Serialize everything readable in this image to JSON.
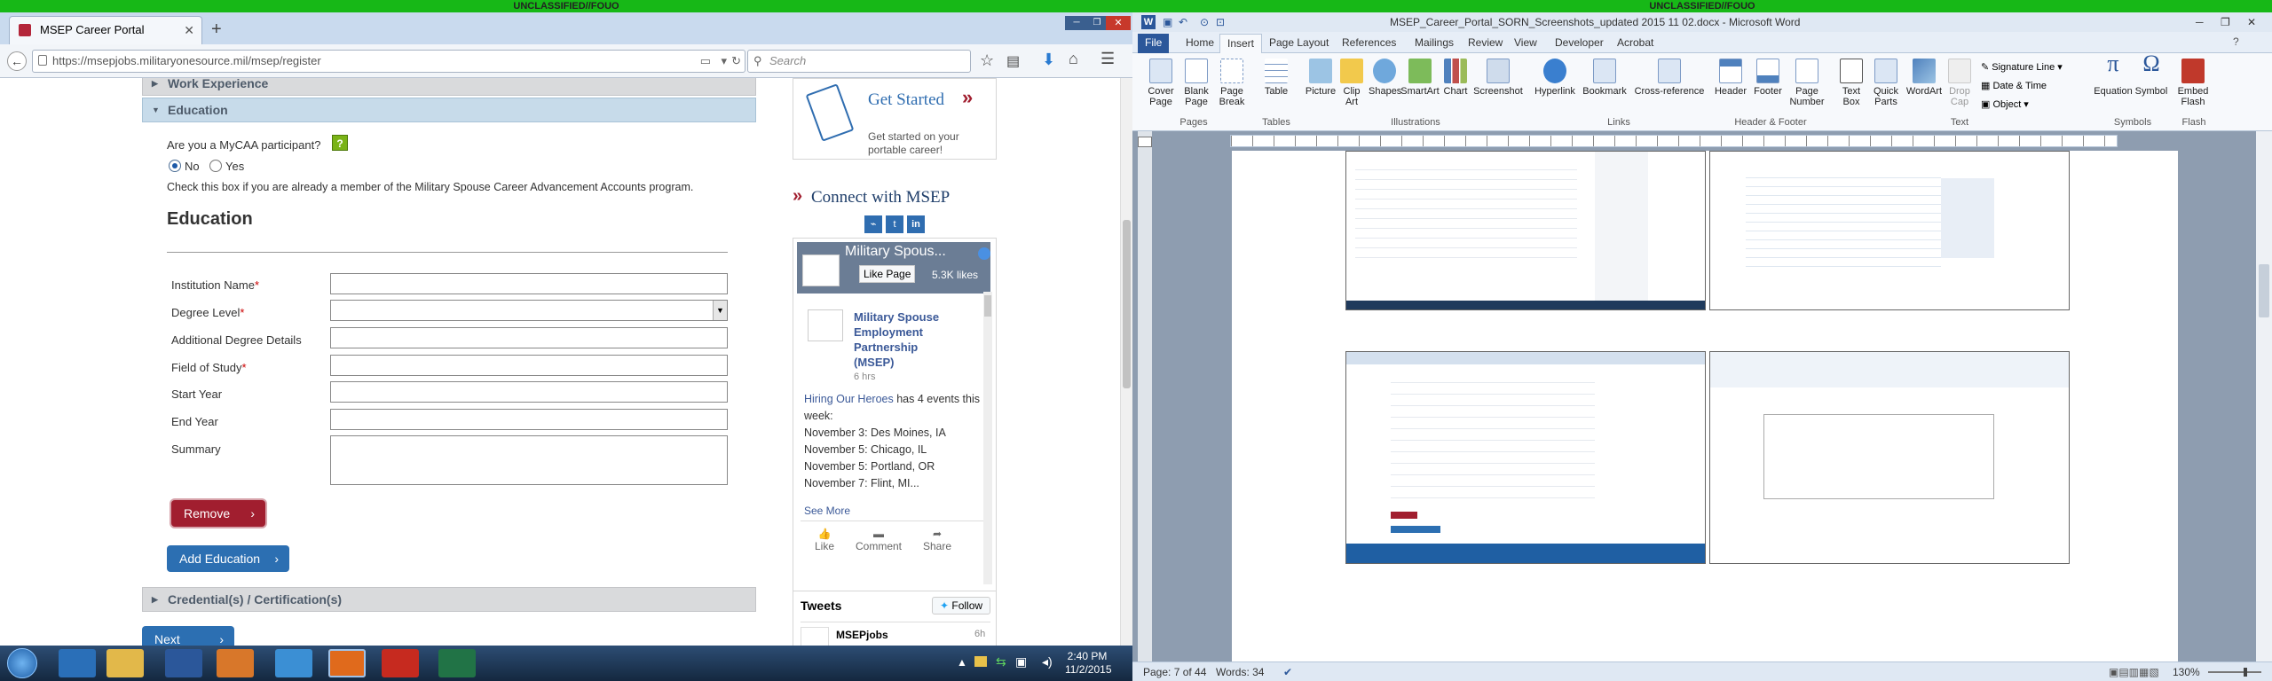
{
  "banner": {
    "left": "UNCLASSIFIED//FOUO",
    "right": "UNCLASSIFIED//FOUO"
  },
  "browser": {
    "tab_title": "MSEP Career Portal",
    "new_tab": "+",
    "url": "https://msepjobs.militaryonesource.mil/msep/register",
    "search_placeholder": "Search"
  },
  "form": {
    "sections": {
      "work_experience": "Work Experience",
      "education": "Education",
      "credentials": "Credential(s) / Certification(s)"
    },
    "mycaa_question": "Are you a MyCAA participant?",
    "mycaa_help": "?",
    "radio_no": "No",
    "radio_yes": "Yes",
    "mycaa_hint": "Check this box if you are already a member of the Military Spouse Career Advancement Accounts program.",
    "heading": "Education",
    "fields": {
      "institution": "Institution Name",
      "degree": "Degree Level",
      "additional": "Additional Degree Details",
      "field": "Field of Study",
      "start": "Start Year",
      "end": "End Year",
      "summary": "Summary"
    },
    "required_mark": "*",
    "remove_button": "Remove",
    "add_button": "Add Education",
    "next_button": "Next"
  },
  "sidebar": {
    "get_started_title": "Get Started",
    "get_started_text": "Get started on your portable career!",
    "connect_title": "Connect with MSEP",
    "fb_page_name": "Military Spous...",
    "fb_like": "Like Page",
    "fb_likes": "5.3K likes",
    "post_author": "Military Spouse Employment Partnership (MSEP)",
    "post_time": "6 hrs",
    "post_link": "Hiring Our Heroes",
    "post_text": " has 4 events this week:",
    "events": [
      "November 3: Des Moines, IA",
      "November 5: Chicago, IL",
      "November 5: Portland, OR",
      "November 7: Flint, MI..."
    ],
    "see_more": "See More",
    "actions": [
      "Like",
      "Comment",
      "Share"
    ],
    "tweets_title": "Tweets",
    "follow": "Follow",
    "tweet_author": "MSEPjobs",
    "tweet_time": "6h"
  },
  "taskbar": {
    "time": "2:40 PM",
    "date": "11/2/2015"
  },
  "word": {
    "title": "MSEP_Career_Portal_SORN_Screenshots_updated 2015 11 02.docx - Microsoft Word",
    "tabs": [
      "File",
      "Home",
      "Insert",
      "Page Layout",
      "References",
      "Mailings",
      "Review",
      "View",
      "Developer",
      "Acrobat"
    ],
    "buttons": [
      "Cover Page",
      "Blank Page",
      "Page Break",
      "Table",
      "Picture",
      "Clip Art",
      "Shapes",
      "SmartArt",
      "Chart",
      "Screenshot",
      "Hyperlink",
      "Bookmark",
      "Cross-reference",
      "Header",
      "Footer",
      "Page Number",
      "Text Box",
      "Quick Parts",
      "WordArt",
      "Drop Cap",
      "Equation",
      "Symbol",
      "Embed Flash"
    ],
    "small_buttons": [
      "Signature Line",
      "Date & Time",
      "Object"
    ],
    "groups": [
      "Pages",
      "Tables",
      "Illustrations",
      "Links",
      "Header & Footer",
      "Text",
      "Symbols",
      "Flash"
    ],
    "status_page": "Page: 7 of 44",
    "status_words": "Words: 34",
    "zoom": "130%"
  },
  "colors": {
    "banner": "#17b817",
    "ff_tab": "#c9daee",
    "accent_red": "#a11e2f",
    "accent_blue": "#2c6fb2",
    "word_blue": "#2b579a"
  }
}
